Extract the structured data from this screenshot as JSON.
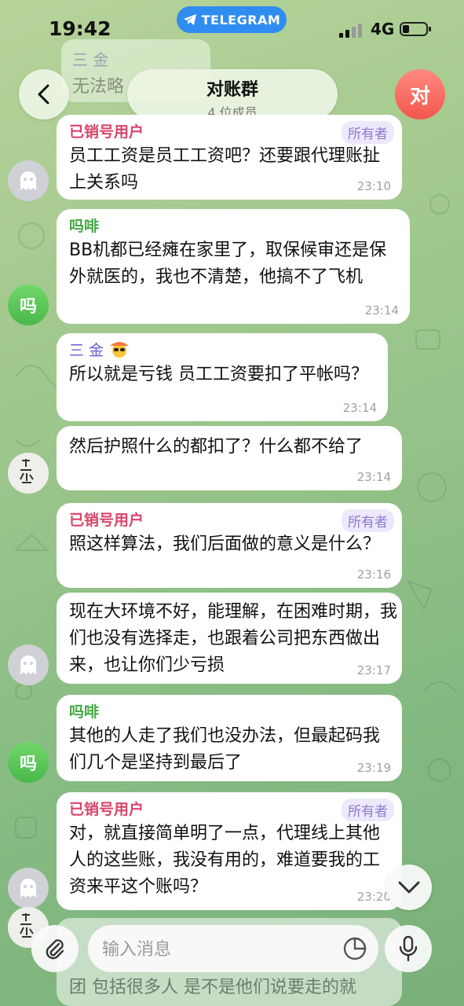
{
  "status_bar": {
    "time": "19:42",
    "app_pill": "TELEGRAM",
    "network": "4G"
  },
  "header": {
    "title": "对账群",
    "subtitle": "4 位成员",
    "group_avatar_letter": "对"
  },
  "faded_message": {
    "name": "三 金",
    "text": "无法略"
  },
  "messages": [
    {
      "sender": "已销号用户",
      "role": "所有者",
      "text": "员工工资是员工工资吧？还要跟代理账扯上关系吗",
      "time": "23:10"
    },
    {
      "sender": "吗啡",
      "text": "BB机都已经瘫在家里了，取保候审还是保外就医的，我也不清楚，他搞不了飞机",
      "time": "23:14",
      "avatar_letter": "吗"
    },
    {
      "sender": "三 金",
      "text": "所以就是亏钱 员工工资要扣了平帐吗？",
      "time": "23:14"
    },
    {
      "text": "然后护照什么的都扣了？什么都不给了",
      "time": "23:14"
    },
    {
      "sender": "已销号用户",
      "role": "所有者",
      "text": "照这样算法，我们后面做的意义是什么？",
      "time": "23:16"
    },
    {
      "text": "现在大环境不好，能理解，在困难时期，我们也没有选择走，也跟着公司把东西做出来，也让你们少亏损",
      "time": "23:17"
    },
    {
      "sender": "吗啡",
      "text": "其他的人走了我们也没办法，但最起码我们几个是坚持到最后了",
      "time": "23:19",
      "avatar_letter": "吗"
    },
    {
      "sender": "已销号用户",
      "role": "所有者",
      "text": "对，就直接简单明了一点，代理线上其他人的这些账，我没有用的，难道要我的工资来平这个账吗？",
      "time": "23:20"
    }
  ],
  "partial_message": {
    "text": "团 包括很多人 是不是他们说要走的就"
  },
  "composer": {
    "placeholder": "输入消息"
  },
  "colors": {
    "owner_name": "#d9456a",
    "mafei_name": "#45a845",
    "sanjin_name": "#6b5ad6",
    "telegram_blue": "#2f8cf0"
  }
}
